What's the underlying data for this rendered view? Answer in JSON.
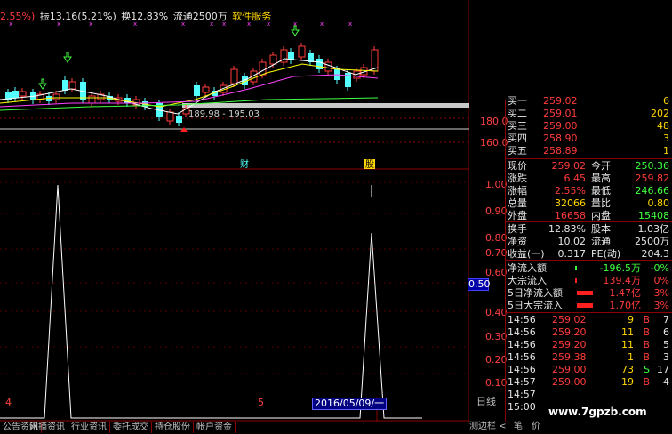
{
  "top_info": {
    "change_pct": "2.55%)",
    "amplitude": "振13.16(5.21%)",
    "turnover": "换12.83%",
    "float": "流通2500万",
    "service": "软件服务"
  },
  "price_scale": [
    "180.0",
    "160.0"
  ],
  "indicator_scale": [
    "1.00",
    "0.90",
    "0.80",
    "0.70",
    "0.60",
    "0.50",
    "0.40",
    "0.30",
    "0.20",
    "0.10"
  ],
  "price_range_label": "189.98 - 195.03",
  "event_tags": [
    "财",
    "股"
  ],
  "cursor_value": "0.50",
  "date_cursor": "2016/05/09/一",
  "x_labels": [
    "4",
    "5"
  ],
  "daily_label": "日线",
  "tabs": [
    "公告资讯",
    "网摘资讯",
    "行业资讯",
    "委托成交",
    "持仓股份",
    "帐户资金"
  ],
  "bottom_right": {
    "a": "测边栏 <",
    "b": "笔",
    "c": "价"
  },
  "watermark": "www.7gpzb.com",
  "bids": [
    {
      "label": "买一",
      "price": "259.02",
      "vol": "6"
    },
    {
      "label": "买二",
      "price": "259.01",
      "vol": "202"
    },
    {
      "label": "买三",
      "price": "259.00",
      "vol": "48"
    },
    {
      "label": "买四",
      "price": "258.90",
      "vol": "3"
    },
    {
      "label": "买五",
      "price": "258.89",
      "vol": "1"
    }
  ],
  "quote": [
    {
      "l1": "现价",
      "v1": "259.02",
      "l2": "今开",
      "v2": "250.36",
      "c1": "red",
      "c2": "green"
    },
    {
      "l1": "涨跌",
      "v1": "6.45",
      "l2": "最高",
      "v2": "259.82",
      "c1": "red",
      "c2": "red"
    },
    {
      "l1": "涨幅",
      "v1": "2.55%",
      "l2": "最低",
      "v2": "246.66",
      "c1": "red",
      "c2": "green"
    },
    {
      "l1": "总量",
      "v1": "32066",
      "l2": "量比",
      "v2": "0.80",
      "c1": "yellow",
      "c2": "yellow"
    },
    {
      "l1": "外盘",
      "v1": "16658",
      "l2": "内盘",
      "v2": "15408",
      "c1": "red",
      "c2": "green"
    }
  ],
  "stats": [
    {
      "l1": "换手",
      "v1": "12.83%",
      "l2": "股本",
      "v2": "1.03亿"
    },
    {
      "l1": "净资",
      "v1": "10.02",
      "l2": "流通",
      "v2": "2500万"
    },
    {
      "l1": "收益(一)",
      "v1": "0.317",
      "l2": "PE(动)",
      "v2": "204.3"
    }
  ],
  "flows": [
    {
      "label": "净流入额",
      "value": "-196.5万",
      "pct": "-0%",
      "color": "green"
    },
    {
      "label": "大宗流入",
      "value": "139.4万",
      "pct": "0%",
      "color": "red"
    },
    {
      "label": "5日净流入额",
      "value": "1.47亿",
      "pct": "3%",
      "color": "red"
    },
    {
      "label": "5日大宗流入",
      "value": "1.70亿",
      "pct": "3%",
      "color": "red"
    }
  ],
  "ticks": [
    {
      "time": "14:56",
      "price": "259.02",
      "vol": "9",
      "side": "B",
      "n": "7"
    },
    {
      "time": "14:56",
      "price": "259.20",
      "vol": "11",
      "side": "B",
      "n": "6"
    },
    {
      "time": "14:56",
      "price": "259.20",
      "vol": "11",
      "side": "B",
      "n": "5"
    },
    {
      "time": "14:56",
      "price": "259.38",
      "vol": "1",
      "side": "B",
      "n": "3"
    },
    {
      "time": "14:56",
      "price": "259.00",
      "vol": "73",
      "side": "S",
      "n": "17"
    },
    {
      "time": "14:57",
      "price": "259.00",
      "vol": "19",
      "side": "B",
      "n": "4"
    },
    {
      "time": "14:57",
      "price": "",
      "vol": "",
      "side": "",
      "n": ""
    },
    {
      "time": "15:00",
      "price": "",
      "vol": "",
      "side": "",
      "n": ""
    }
  ],
  "colors": {
    "up": "#ff3b3b",
    "down": "#54ffff",
    "border": "#8b0000"
  }
}
